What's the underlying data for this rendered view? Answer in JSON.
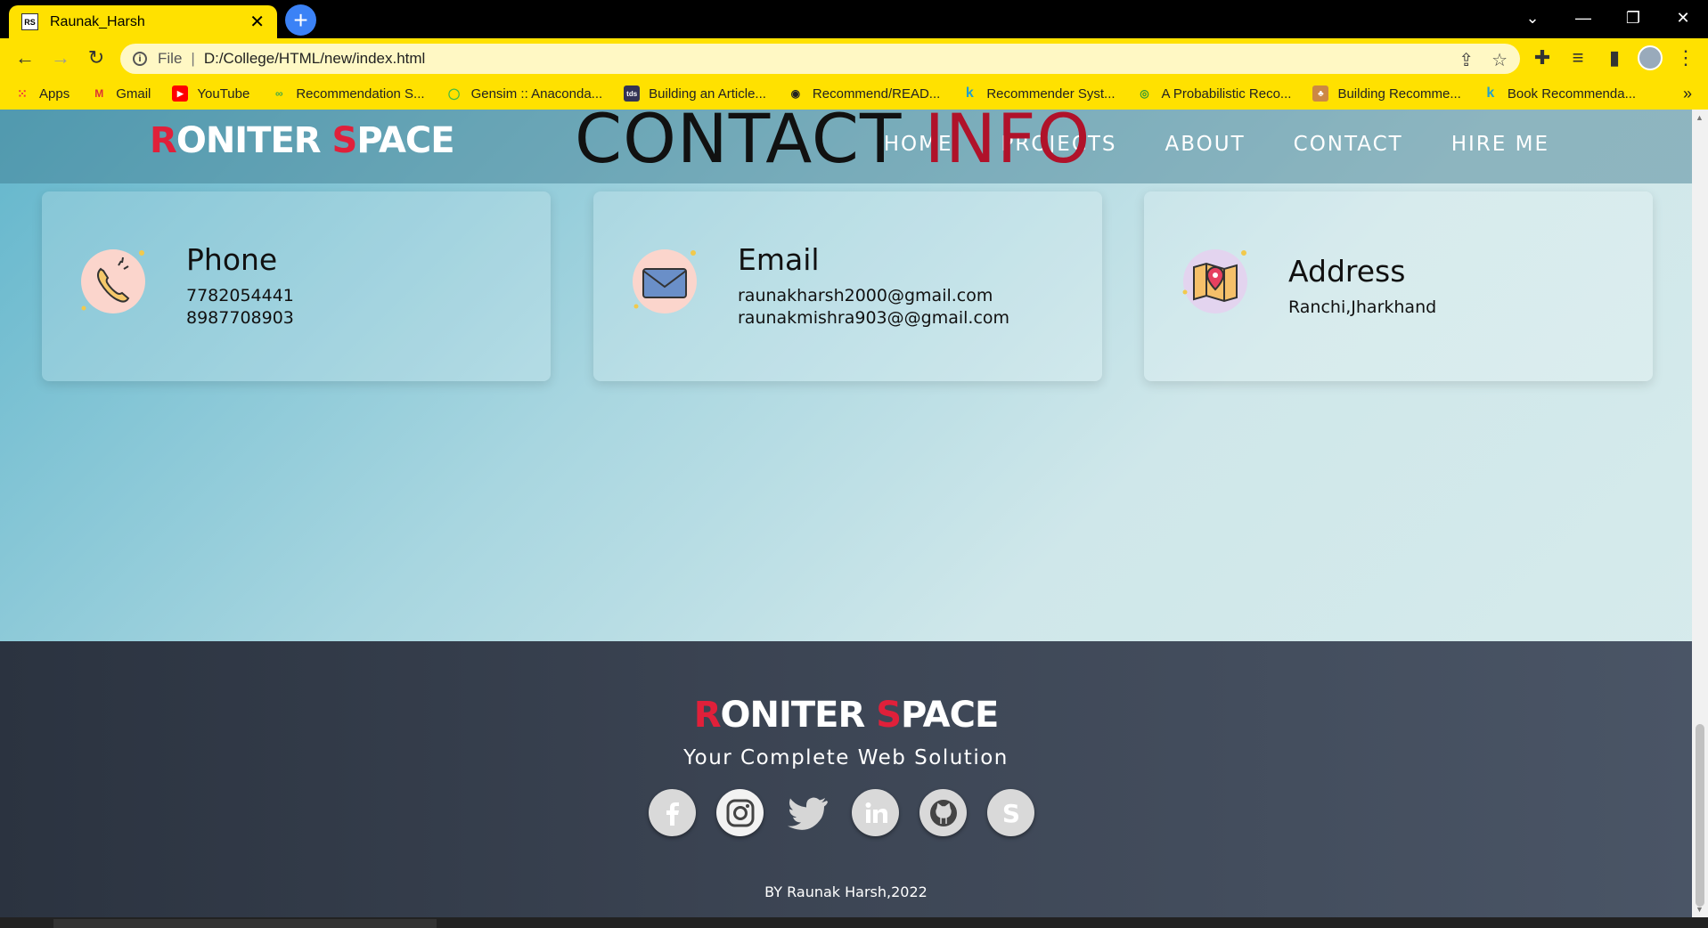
{
  "browser": {
    "tab_title": "Raunak_Harsh",
    "tab_favicon": "RS",
    "url_scheme": "File",
    "url": "D:/College/HTML/new/index.html",
    "bookmarks": [
      {
        "label": "Apps",
        "icon": "apps-grid-icon"
      },
      {
        "label": "Gmail",
        "icon": "gmail-icon"
      },
      {
        "label": "YouTube",
        "icon": "youtube-icon"
      },
      {
        "label": "Recommendation S...",
        "icon": "goodreads-icon"
      },
      {
        "label": "Gensim :: Anaconda...",
        "icon": "anaconda-icon"
      },
      {
        "label": "Building an Article...",
        "icon": "tds-icon"
      },
      {
        "label": "Recommend/READ...",
        "icon": "github-icon"
      },
      {
        "label": "Recommender Syst...",
        "icon": "kaggle-icon"
      },
      {
        "label": "A Probabilistic Reco...",
        "icon": "globe-icon"
      },
      {
        "label": "Building Recomme...",
        "icon": "site-icon"
      },
      {
        "label": "Book Recommenda...",
        "icon": "kaggle-icon"
      }
    ]
  },
  "site": {
    "logo_first_letter": "R",
    "logo_first_rest": "ONITER ",
    "logo_second_letter": "S",
    "logo_second_rest": "PACE",
    "section_title_dark": "CONTACT ",
    "section_title_red": "INFO",
    "nav": [
      "HOME",
      "PROJECTS",
      "ABOUT",
      "CONTACT",
      "HIRE ME"
    ]
  },
  "contact_cards": [
    {
      "title": "Phone",
      "lines": [
        "7782054441",
        "8987708903"
      ],
      "icon": "phone-icon"
    },
    {
      "title": "Email",
      "lines": [
        "raunakharsh2000@gmail.com",
        "raunakmishra903@@gmail.com"
      ],
      "icon": "envelope-icon"
    },
    {
      "title": "Address",
      "lines": [
        "Ranchi,Jharkhand"
      ],
      "icon": "map-pin-icon"
    }
  ],
  "footer": {
    "tagline": "Your Complete Web Solution",
    "socials": [
      "facebook-icon",
      "instagram-icon",
      "twitter-icon",
      "linkedin-icon",
      "github-icon",
      "skype-icon"
    ],
    "copyright": "BY Raunak Harsh,2022"
  },
  "colors": {
    "chrome_accent": "#ffe100",
    "brand_red": "#e0203a",
    "footer_bg": "#3d4655"
  }
}
